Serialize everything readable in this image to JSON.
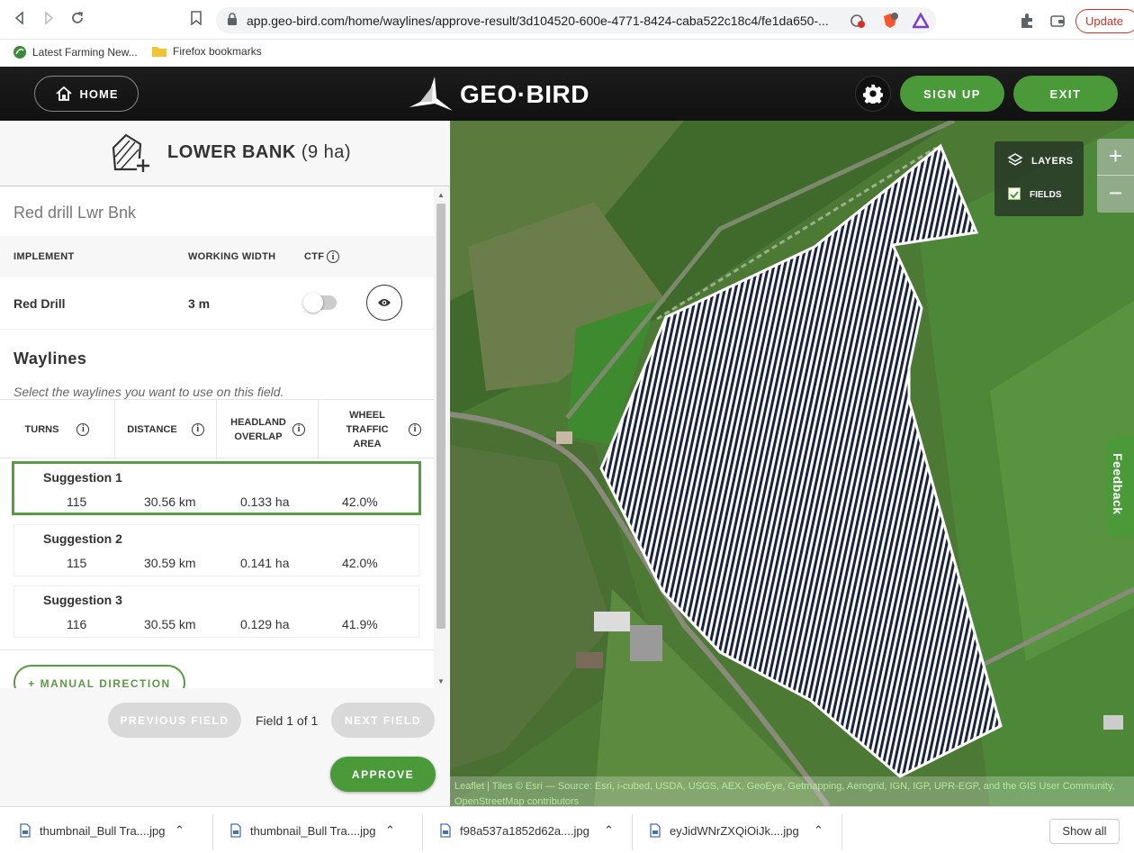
{
  "browser": {
    "url": "app.geo-bird.com/home/waylines/approve-result/3d104520-600e-4771-8424-caba522c18c4/fe1da650-...",
    "update_label": "Update",
    "bookmarks": [
      "Latest Farming New...",
      "Firefox bookmarks"
    ]
  },
  "header": {
    "home_label": "HOME",
    "logo_text": "GEO·BIRD",
    "signup_label": "SIGN UP",
    "exit_label": "EXIT"
  },
  "field": {
    "name": "LOWER BANK",
    "area": "(9 ha)"
  },
  "plan": {
    "name": "Red drill Lwr Bnk",
    "col_implement": "IMPLEMENT",
    "col_width": "WORKING WIDTH",
    "col_ctf": "CTF",
    "implement": "Red Drill",
    "width": "3 m"
  },
  "waylines": {
    "title": "Waylines",
    "subtitle": "Select the waylines you want to use on this field.",
    "columns": [
      "TURNS",
      "DISTANCE",
      "HEADLAND OVERLAP",
      "WHEEL TRAFFIC AREA"
    ],
    "suggestions": [
      {
        "name": "Suggestion 1",
        "turns": "115",
        "distance": "30.56 km",
        "overlap": "0.133 ha",
        "traffic": "42.0%"
      },
      {
        "name": "Suggestion 2",
        "turns": "115",
        "distance": "30.59 km",
        "overlap": "0.141 ha",
        "traffic": "42.0%"
      },
      {
        "name": "Suggestion 3",
        "turns": "116",
        "distance": "30.55 km",
        "overlap": "0.129 ha",
        "traffic": "41.9%"
      }
    ],
    "manual_label": "+ MANUAL DIRECTION"
  },
  "pager": {
    "prev_label": "PREVIOUS FIELD",
    "status": "Field 1 of 1",
    "next_label": "NEXT FIELD",
    "approve_label": "APPROVE"
  },
  "map": {
    "layers_label": "LAYERS",
    "fields_label": "FIELDS",
    "zoom_in": "+",
    "zoom_out": "−",
    "feedback_label": "Feedback",
    "attribution_line1": "Leaflet | Tiles © Esri — Source: Esri, i-cubed, USDA, USGS, AEX, GeoEye, Getmapping, Aerogrid, IGN, IGP, UPR-EGP, and the GIS User Community,",
    "attribution_line2": "OpenStreetMap contributors"
  },
  "downloads": {
    "items": [
      "thumbnail_Bull Tra....jpg",
      "thumbnail_Bull Tra....jpg",
      "f98a537a1852d62a....jpg",
      "eyJidWNrZXQiOiJk....jpg"
    ],
    "show_all": "Show all"
  },
  "colors": {
    "brand_green": "#4a9a3a",
    "selected_border": "#5b9a45",
    "header_bg": "#151515"
  }
}
